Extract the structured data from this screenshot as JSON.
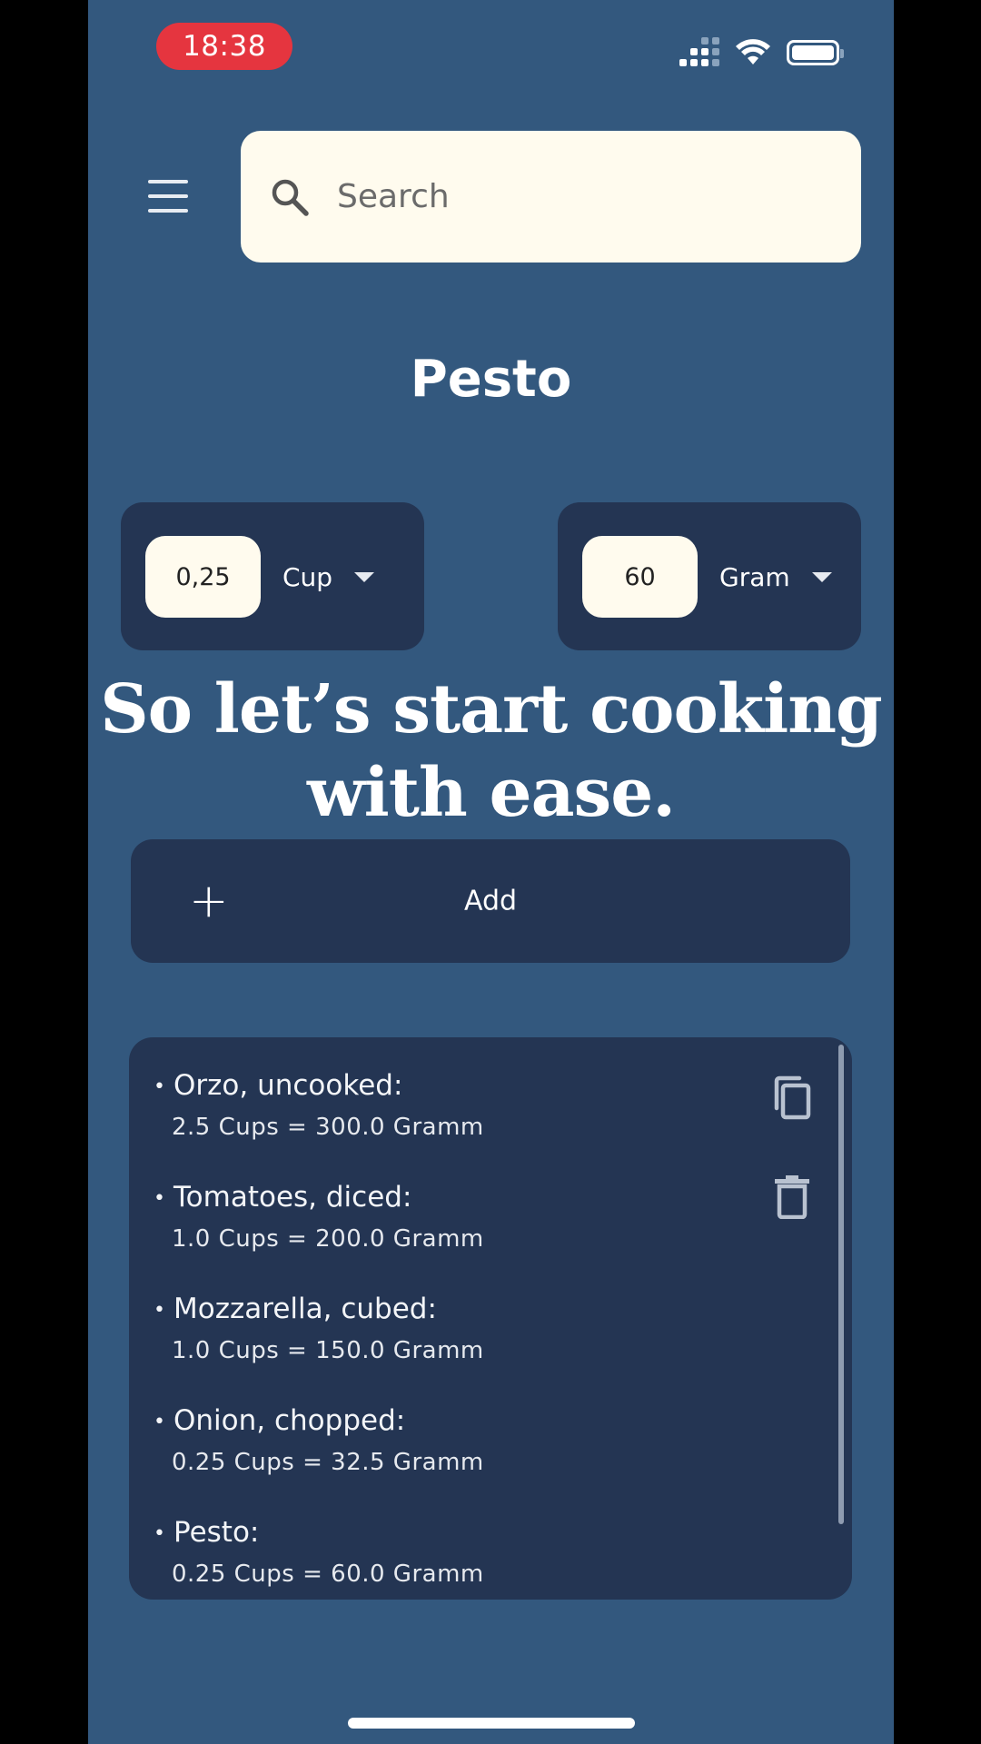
{
  "status_bar": {
    "time": "18:38",
    "icons": [
      "signal-icon",
      "wifi-icon",
      "battery-icon"
    ]
  },
  "header": {
    "menu_icon": "hamburger-menu-icon",
    "search": {
      "placeholder": "Search",
      "value": "",
      "icon": "search-icon"
    }
  },
  "recipe": {
    "title": "Pesto"
  },
  "converter": {
    "from": {
      "amount": "0,25",
      "unit": "Cup"
    },
    "to": {
      "amount": "60",
      "unit": "Gram"
    }
  },
  "tagline": {
    "line1": "So let’s start cooking",
    "line2": "with ease."
  },
  "add_button": {
    "label": "Add",
    "icon": "plus-icon"
  },
  "ingredients": [
    {
      "name": "Orzo, uncooked:",
      "conversion": "2.5 Cups = 300.0 Gramm"
    },
    {
      "name": "Tomatoes, diced:",
      "conversion": "1.0 Cups = 200.0 Gramm"
    },
    {
      "name": "Mozzarella, cubed:",
      "conversion": "1.0 Cups = 150.0 Gramm"
    },
    {
      "name": "Onion, chopped:",
      "conversion": "0.25 Cups = 32.5 Gramm"
    },
    {
      "name": "Pesto:",
      "conversion": "0.25 Cups = 60.0 Gramm"
    }
  ],
  "list_actions": {
    "copy_icon": "copy-icon",
    "delete_icon": "trash-icon"
  },
  "colors": {
    "background": "#33587e",
    "card": "#243553",
    "field": "#fffbee",
    "time_pill": "#e5353f"
  }
}
